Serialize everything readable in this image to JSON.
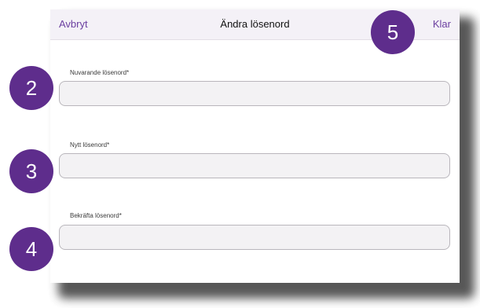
{
  "navbar": {
    "cancel_label": "Avbryt",
    "title": "Ändra lösenord",
    "done_label": "Klar"
  },
  "fields": [
    {
      "label": "Nuvarande lösenord*",
      "value": ""
    },
    {
      "label": "Nytt lösenord*",
      "value": ""
    },
    {
      "label": "Bekräfta lösenord*",
      "value": ""
    }
  ],
  "badges": {
    "step_2": "2",
    "step_3": "3",
    "step_4": "4",
    "step_5": "5"
  },
  "colors": {
    "accent": "#6b3fa0",
    "badge": "#5e2d8c",
    "navbar_bg": "#f4f1f7"
  }
}
